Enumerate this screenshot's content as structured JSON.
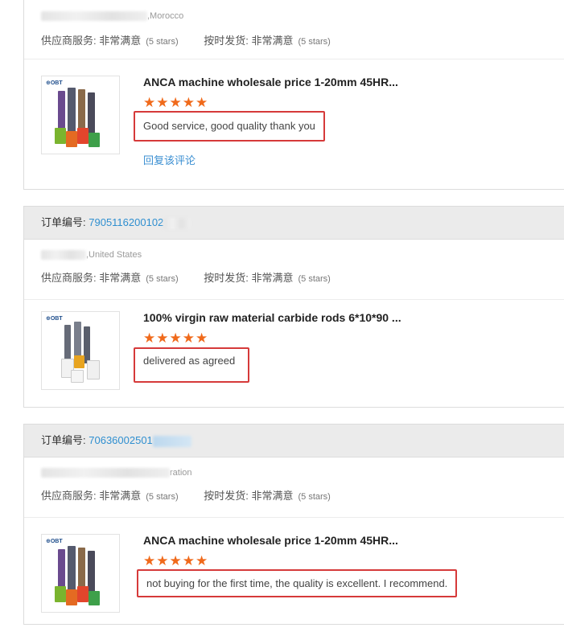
{
  "labels": {
    "order_no": "订单编号:",
    "supplier_service": "供应商服务:",
    "on_time_delivery": "按时发货:",
    "rating_value": "非常满意",
    "rating_stars": "(5 stars)",
    "reply": "回复该评论",
    "star_glyphs": "★★★★★"
  },
  "reviews": [
    {
      "location": ",Morocco",
      "product_title": "ANCA machine wholesale price 1-20mm 45HR...",
      "review_text": "Good service, good quality thank you",
      "stars": 5
    },
    {
      "order_number": "7905116200102",
      "location": ",United States",
      "product_title": "100% virgin raw material carbide rods 6*10*90 ...",
      "review_text": "delivered as agreed",
      "stars": 5
    },
    {
      "order_number": "70636002501",
      "location": "ration",
      "product_title": "ANCA machine wholesale price 1-20mm 45HR...",
      "review_text": "not buying for the first time, the quality is excellent. I recommend.",
      "stars": 5
    }
  ],
  "colors": {
    "accent_link": "#2f8fd0",
    "star": "#f06a1b",
    "highlight_box": "#d63a3a",
    "header_bg": "#ebebeb"
  }
}
